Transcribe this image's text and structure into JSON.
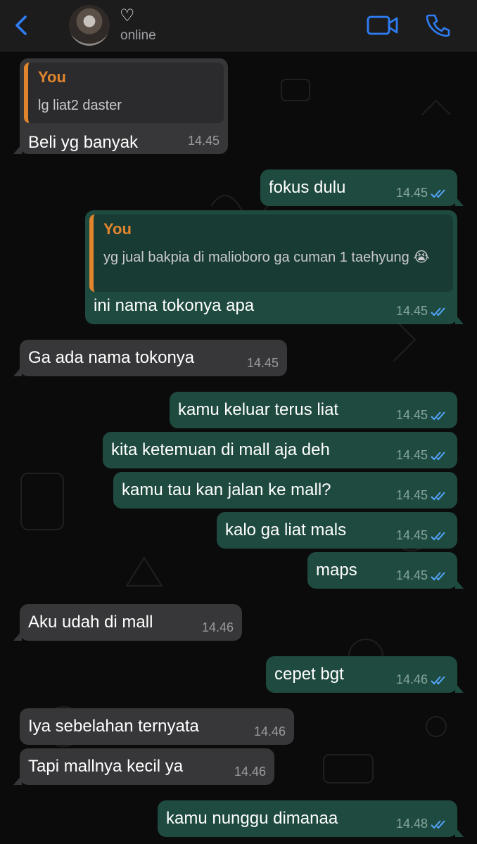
{
  "header": {
    "contact_name": "♡",
    "status": "online",
    "colors": {
      "accent": "#2f7ef6",
      "bar": "#1c1c1d"
    }
  },
  "messages": [
    {
      "dir": "in",
      "quote_name": "You",
      "quote_text": "lg liat2 daster",
      "text": "Beli yg banyak",
      "time": "14.45"
    },
    {
      "dir": "out",
      "text": "fokus dulu",
      "time": "14.45",
      "ticks": "read"
    },
    {
      "dir": "out",
      "quote_name": "You",
      "quote_text": "yg jual bakpia di malioboro ga cuman 1 taehyung 😭",
      "text": "ini nama tokonya apa",
      "time": "14.45",
      "ticks": "read"
    },
    {
      "dir": "in",
      "text": "Ga ada nama tokonya",
      "time": "14.45"
    },
    {
      "dir": "out",
      "text": "kamu keluar terus liat",
      "time": "14.45",
      "ticks": "read"
    },
    {
      "dir": "out",
      "text": "kita ketemuan di mall aja deh",
      "time": "14.45",
      "ticks": "read"
    },
    {
      "dir": "out",
      "text": "kamu tau kan jalan ke mall?",
      "time": "14.45",
      "ticks": "read"
    },
    {
      "dir": "out",
      "text": "kalo ga liat mals",
      "time": "14.45",
      "ticks": "read"
    },
    {
      "dir": "out",
      "text": "maps",
      "time": "14.45",
      "ticks": "read"
    },
    {
      "dir": "in",
      "text": "Aku udah di mall",
      "time": "14.46"
    },
    {
      "dir": "out",
      "text": "cepet bgt",
      "time": "14.46",
      "ticks": "read"
    },
    {
      "dir": "in",
      "text": "Iya sebelahan ternyata",
      "time": "14.46"
    },
    {
      "dir": "in",
      "text": "Tapi mallnya kecil ya",
      "time": "14.46"
    },
    {
      "dir": "out",
      "text": "kamu nunggu dimanaa",
      "time": "14.48",
      "ticks": "read"
    }
  ],
  "icons": {
    "back": "chevron-left-icon",
    "video": "video-camera-icon",
    "call": "phone-icon",
    "read_receipt": "double-check-icon"
  },
  "colors": {
    "incoming_bubble": "#373739",
    "outgoing_bubble": "#1f4a40",
    "quote_author": "#e0852d",
    "read_ticks": "#53a6fd"
  }
}
